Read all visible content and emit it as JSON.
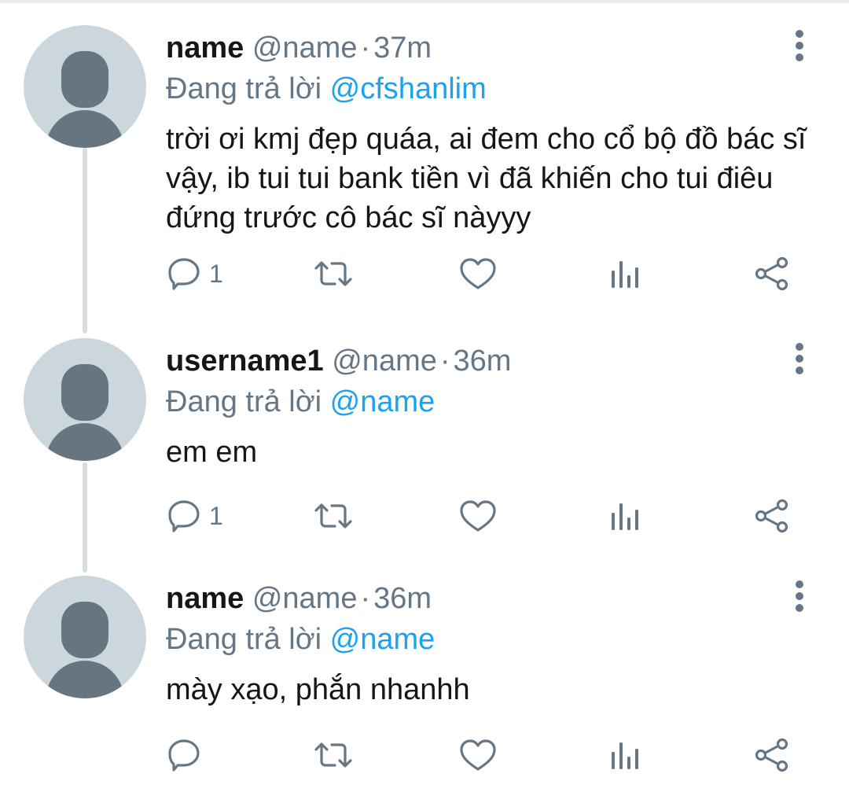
{
  "tweets": [
    {
      "username": "name",
      "handle": "@name",
      "time": "37m",
      "replying_prefix": "Đang trả lời",
      "replying_to": "@cfshanlim",
      "text": "trời ơi kmj đẹp quáa, ai đem cho cổ bộ đồ bác sĩ vậy, ib tui tui bank tiền vì đã khiến cho tui điêu đứng trước cô bác sĩ nàyyy",
      "reply_count": "1"
    },
    {
      "username": "username1",
      "handle": "@name",
      "time": "36m",
      "replying_prefix": "Đang trả lời",
      "replying_to": "@name",
      "text": "em em",
      "reply_count": "1"
    },
    {
      "username": "name",
      "handle": "@name",
      "time": "36m",
      "replying_prefix": "Đang trả lời",
      "replying_to": "@name",
      "text": "mày xạo, phắn nhanhh",
      "reply_count": ""
    }
  ],
  "icons": {
    "reply": "reply-icon",
    "retweet": "retweet-icon",
    "like": "heart-icon",
    "analytics": "analytics-icon",
    "share": "share-icon",
    "more": "more-icon"
  },
  "colors": {
    "primary_text": "#14171a",
    "secondary_text": "#657786",
    "mention": "#1da1f2",
    "avatar_bg": "#ccd6dd",
    "avatar_fg": "#66757f",
    "thread_line": "#d5dbdf"
  }
}
